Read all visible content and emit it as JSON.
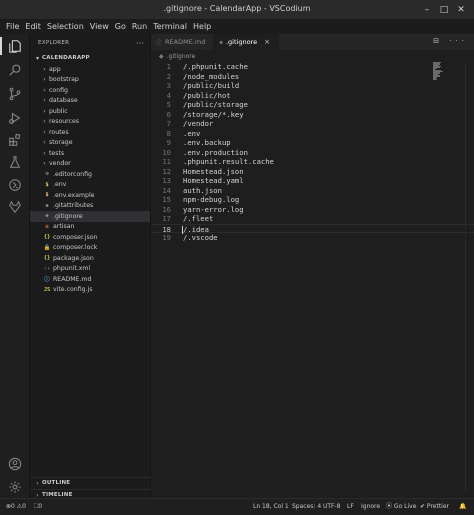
{
  "window": {
    "title": ".gitignore - CalendarApp - VSCodium",
    "minimize": "–",
    "maximize": "□",
    "close": "✕"
  },
  "menu": [
    "File",
    "Edit",
    "Selection",
    "View",
    "Go",
    "Run",
    "Terminal",
    "Help"
  ],
  "activity_bar": {
    "top": [
      "explorer-icon",
      "search-icon",
      "source-control-icon",
      "run-debug-icon",
      "extensions-icon",
      "testing-icon",
      "remote-icon",
      "gitlab-icon"
    ],
    "bottom": [
      "account-icon",
      "settings-gear-icon"
    ]
  },
  "explorer": {
    "title": "EXPLORER",
    "more": "···",
    "project": "CALENDARAPP",
    "folders": [
      "app",
      "bootstrap",
      "config",
      "database",
      "public",
      "resources",
      "routes",
      "storage",
      "tests",
      "vendor"
    ],
    "files": [
      {
        "name": ".editorconfig",
        "icon": "⚙",
        "color": "#9da5b4"
      },
      {
        "name": ".env",
        "icon": "$",
        "color": "#e5c07b"
      },
      {
        "name": ".env.example",
        "icon": "$",
        "color": "#e5c07b"
      },
      {
        "name": ".gitattributes",
        "icon": "◆",
        "color": "#8c8c8c"
      },
      {
        "name": ".gitignore",
        "icon": "◆",
        "color": "#8c8c8c",
        "selected": true
      },
      {
        "name": "artisan",
        "icon": "≡",
        "color": "#e37933"
      },
      {
        "name": "composer.json",
        "icon": "{}",
        "color": "#d8c64b"
      },
      {
        "name": "composer.lock",
        "icon": "🔒",
        "color": "#c8b040"
      },
      {
        "name": "package.json",
        "icon": "{}",
        "color": "#d8c64b"
      },
      {
        "name": "phpunit.xml",
        "icon": "‹›",
        "color": "#e37933"
      },
      {
        "name": "README.md",
        "icon": "ⓘ",
        "color": "#519aba"
      },
      {
        "name": "vite.config.js",
        "icon": "JS",
        "color": "#cbcb41"
      }
    ],
    "outline": "OUTLINE",
    "timeline": "TIMELINE"
  },
  "tabs": [
    {
      "label": "README.md",
      "icon": "ⓘ",
      "active": false
    },
    {
      "label": ".gitignore",
      "icon": "◆",
      "active": true,
      "close": "×"
    }
  ],
  "editor_actions": "⊟ ···",
  "breadcrumb": ".gitignore",
  "code": [
    "/.phpunit.cache",
    "/node_modules",
    "/public/build",
    "/public/hot",
    "/public/storage",
    "/storage/*.key",
    "/vendor",
    ".env",
    ".env.backup",
    ".env.production",
    ".phpunit.result.cache",
    "Homestead.json",
    "Homestead.yaml",
    "auth.json",
    "npm-debug.log",
    "yarn-error.log",
    "/.fleet",
    "/.idea",
    "/.vscode"
  ],
  "current_line": 18,
  "status": {
    "problems": "⊗0 ⚠0",
    "ports": "⛶0",
    "cursor": "Ln 18, Col 1",
    "spaces": "Spaces: 4",
    "encoding": "UTF-8",
    "eol": "LF",
    "language": "Ignore",
    "golive": "Go Live",
    "prettier": "✔ Prettier",
    "bell": "🔔"
  }
}
